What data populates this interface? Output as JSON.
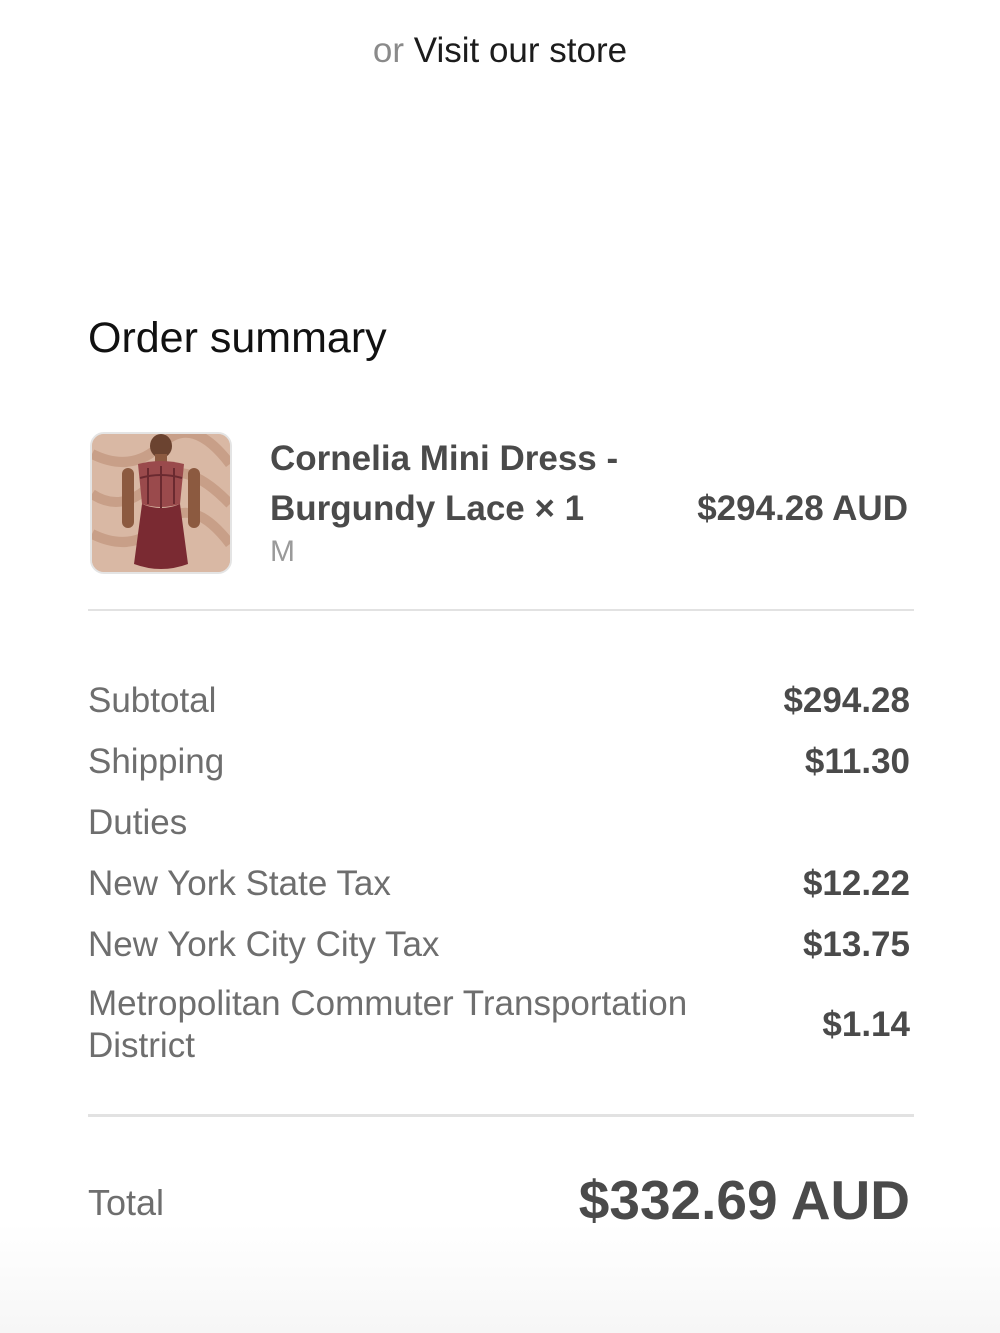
{
  "store": {
    "or_text": "or",
    "link_text": "Visit our store"
  },
  "summary": {
    "title": "Order summary"
  },
  "line_item": {
    "name": "Cornelia Mini Dress - Burgundy Lace × 1",
    "variant": "M",
    "price": "$294.28 AUD",
    "image_description": "product-photo",
    "colors": {
      "dress": "#7a2a32",
      "background": "#d9b8a4"
    }
  },
  "costs": {
    "subtotal": {
      "label": "Subtotal",
      "value": "$294.28"
    },
    "shipping": {
      "label": "Shipping",
      "value": "$11.30"
    },
    "duties": {
      "label": "Duties",
      "value": ""
    },
    "ny_state_tax": {
      "label": "New York State Tax",
      "value": "$12.22"
    },
    "nyc_city_tax": {
      "label": "New York City City Tax",
      "value": "$13.75"
    },
    "mctd": {
      "label": "Metropolitan Commuter Transportation District",
      "value": "$1.14"
    }
  },
  "total": {
    "label": "Total",
    "value": "$332.69 AUD"
  }
}
